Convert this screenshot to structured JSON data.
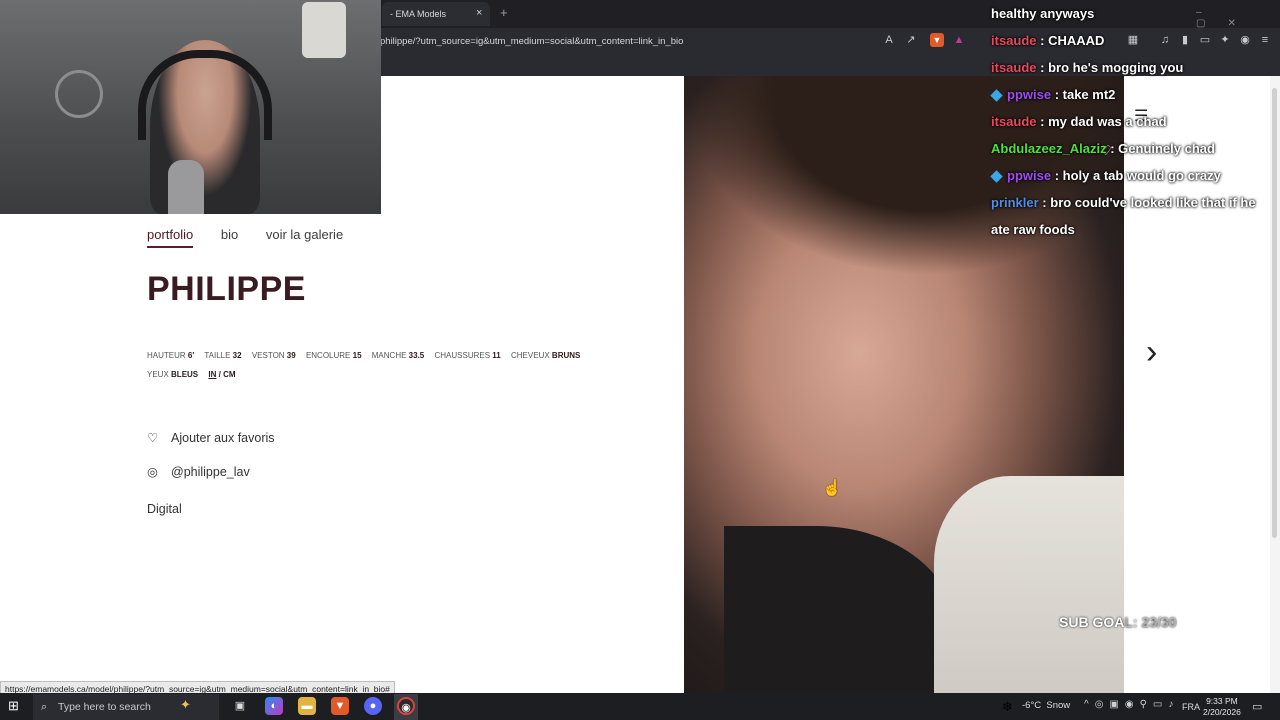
{
  "browser": {
    "tab_title": "- EMA Models",
    "tab_close": "×",
    "new_tab": "+",
    "url": "philippe/?utm_source=ig&utm_medium=social&utm_content=link_in_bio",
    "status_url": "https://emamodels.ca/model/philippe/?utm_source=ig&utm_medium=social&utm_content=link_in_bio#"
  },
  "page": {
    "nav": [
      {
        "label": "portfolio",
        "active": true
      },
      {
        "label": "bio",
        "active": false
      },
      {
        "label": "voir la galerie",
        "active": false
      }
    ],
    "model_name": "PHILIPPE",
    "measurements": [
      {
        "label": "HAUTEUR",
        "value": "6'"
      },
      {
        "label": "TAILLE",
        "value": "32"
      },
      {
        "label": "VESTON",
        "value": "39"
      },
      {
        "label": "ENCOLURE",
        "value": "15"
      },
      {
        "label": "MANCHE",
        "value": "33.5"
      },
      {
        "label": "CHAUSSURES",
        "value": "11"
      },
      {
        "label": "CHEVEUX",
        "value": "BRUNS"
      },
      {
        "label": "YEUX",
        "value": "BLEUS"
      }
    ],
    "units": {
      "in": "IN",
      "sep": " / ",
      "cm": "CM"
    },
    "favorite_label": "Ajouter aux favoris",
    "instagram_handle": "@philippe_lav",
    "digital_label": "Digital",
    "next_arrow": "›"
  },
  "overlay": {
    "sub_goal_label": "SUB GOA",
    "sub_goal_rest": "L: 23/30",
    "chat": [
      {
        "user": "",
        "message": "healthy anyways",
        "color": "#ffffff",
        "badge": false
      },
      {
        "user": "itsaude",
        "message": "CHAAAD",
        "color": "#e8495d",
        "badge": false
      },
      {
        "user": "itsaude",
        "message": "bro he's mogging you",
        "color": "#e8495d",
        "badge": false
      },
      {
        "user": "ppwise",
        "message": "take mt2",
        "color": "#9b4df0",
        "badge": true
      },
      {
        "user": "itsaude",
        "message": "my dad was a chad",
        "color": "#e8495d",
        "badge": false
      },
      {
        "user": "Abdulazeez_Alaziz",
        "message": "Genuinely chad",
        "color": "#4fe03a",
        "badge": false
      },
      {
        "user": "ppwise",
        "message": "holy a tab would go crazy",
        "color": "#9b4df0",
        "badge": true
      },
      {
        "user": "prinkler",
        "message": "bro could've looked like that if he",
        "color": "#4f8ee8",
        "badge": false
      },
      {
        "user": "",
        "message": "ate raw foods",
        "color": "#ffffff",
        "badge": false
      }
    ]
  },
  "taskbar": {
    "search_placeholder": "Type here to search",
    "weather_temp": "-6°C",
    "weather_desc": "Snow",
    "language": "FRA",
    "time": "9:33 PM",
    "date": "2/20/2026"
  }
}
